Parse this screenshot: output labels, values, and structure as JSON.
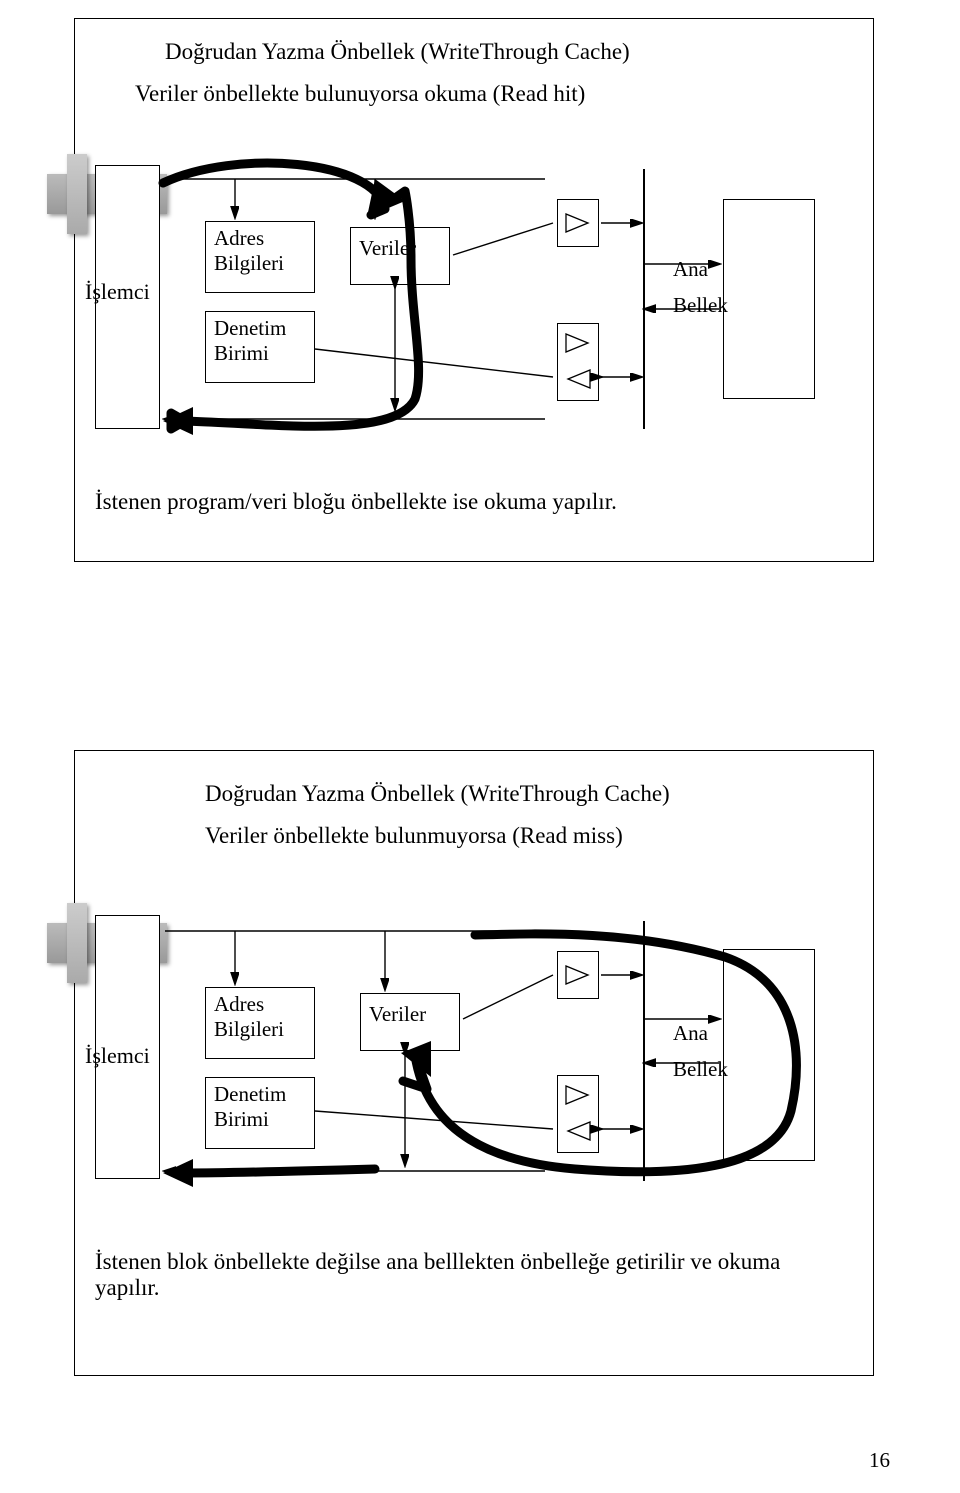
{
  "figures": [
    {
      "title_line1": "Doğrudan Yazma Önbellek (WriteThrough Cache)",
      "title_line2": "Veriler önbellekte bulunuyorsa okuma (Read hit)",
      "processor": "İşlemci",
      "addr": "Adres",
      "addr2": "Bilgileri",
      "ctrl": "Denetim",
      "ctrl2": "Birimi",
      "data": "Veriler",
      "mem1": "Ana",
      "mem2": "Bellek",
      "caption": "İstenen program/veri bloğu önbellekte ise okuma yapılır."
    },
    {
      "title_line1": "Doğrudan Yazma Önbellek (WriteThrough Cache)",
      "title_line2": "Veriler önbellekte bulunmuyorsa (Read miss)",
      "processor": "İşlemci",
      "addr": "Adres",
      "addr2": "Bilgileri",
      "ctrl": "Denetim",
      "ctrl2": "Birimi",
      "data": "Veriler",
      "mem1": "Ana",
      "mem2": "Bellek",
      "caption": "İstenen blok önbellekte değilse ana belllekten önbelleğe getirilir ve okuma yapılır."
    }
  ],
  "page_number": "16"
}
